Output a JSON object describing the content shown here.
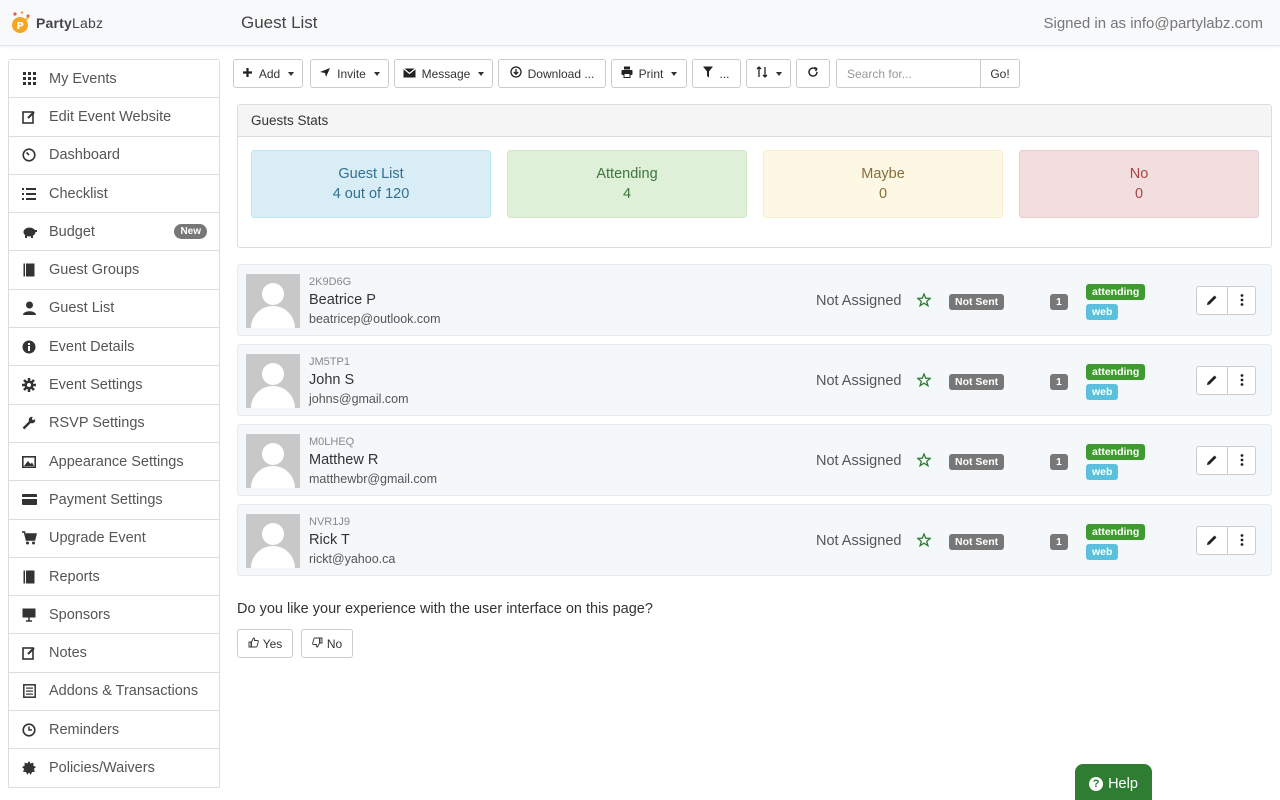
{
  "app": {
    "logo_bold": "Party",
    "logo_rest": "Labz",
    "page_title": "Guest List",
    "signed_in": "Signed in as info@partylabz.com"
  },
  "sidebar": {
    "items": [
      {
        "label": "My Events",
        "icon": "grid-icon"
      },
      {
        "label": "Edit Event Website",
        "icon": "edit-icon"
      },
      {
        "label": "Dashboard",
        "icon": "dashboard-icon"
      },
      {
        "label": "Checklist",
        "icon": "list-icon"
      },
      {
        "label": "Budget",
        "icon": "piggy-bank-icon",
        "badge": "New"
      },
      {
        "label": "Guest Groups",
        "icon": "book-icon"
      },
      {
        "label": "Guest List",
        "icon": "user-icon"
      },
      {
        "label": "Event Details",
        "icon": "info-icon"
      },
      {
        "label": "Event Settings",
        "icon": "gear-icon"
      },
      {
        "label": "RSVP Settings",
        "icon": "wrench-icon"
      },
      {
        "label": "Appearance Settings",
        "icon": "picture-icon"
      },
      {
        "label": "Payment Settings",
        "icon": "credit-card-icon"
      },
      {
        "label": "Upgrade Event",
        "icon": "cart-icon"
      },
      {
        "label": "Reports",
        "icon": "book-icon"
      },
      {
        "label": "Sponsors",
        "icon": "presentation-icon"
      },
      {
        "label": "Notes",
        "icon": "edit-icon"
      },
      {
        "label": "Addons & Transactions",
        "icon": "list-alt-icon"
      },
      {
        "label": "Reminders",
        "icon": "clock-icon"
      },
      {
        "label": "Policies/Waivers",
        "icon": "certificate-icon"
      }
    ]
  },
  "toolbar": {
    "add_label": "Add",
    "invite_label": "Invite",
    "message_label": "Message",
    "download_label": "Download ...",
    "print_label": "Print",
    "filter_label": "...",
    "search_placeholder": "Search for...",
    "go_label": "Go!"
  },
  "stats": {
    "title": "Guests Stats",
    "boxes": [
      {
        "label": "Guest List",
        "value": "4 out of 120"
      },
      {
        "label": "Attending",
        "value": "4"
      },
      {
        "label": "Maybe",
        "value": "0"
      },
      {
        "label": "No",
        "value": "0"
      }
    ]
  },
  "guests": [
    {
      "code": "2K9D6G",
      "name": "Beatrice P",
      "email": "beatricep@outlook.com",
      "table": "Not Assigned",
      "invite": "Not Sent",
      "count": "1",
      "status": "attending",
      "source": "web"
    },
    {
      "code": "JM5TP1",
      "name": "John S",
      "email": "johns@gmail.com",
      "table": "Not Assigned",
      "invite": "Not Sent",
      "count": "1",
      "status": "attending",
      "source": "web"
    },
    {
      "code": "M0LHEQ",
      "name": "Matthew R",
      "email": "matthewbr@gmail.com",
      "table": "Not Assigned",
      "invite": "Not Sent",
      "count": "1",
      "status": "attending",
      "source": "web"
    },
    {
      "code": "NVR1J9",
      "name": "Rick T",
      "email": "rickt@yahoo.ca",
      "table": "Not Assigned",
      "invite": "Not Sent",
      "count": "1",
      "status": "attending",
      "source": "web"
    }
  ],
  "feedback": {
    "question": "Do you like your experience with the user interface on this page?",
    "yes_label": "Yes",
    "no_label": "No"
  },
  "help": {
    "label": "Help"
  },
  "colors": {
    "accent_green": "#2e7d32",
    "status_green": "#3f9b2f",
    "source_blue": "#5bc0de",
    "badge_gray": "#777777"
  }
}
